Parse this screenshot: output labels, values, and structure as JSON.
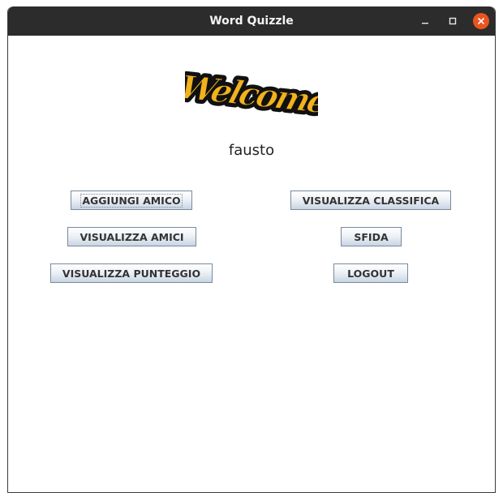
{
  "window": {
    "title": "Word Quizzle"
  },
  "logo": {
    "text": "Welcome",
    "fill_color": "#f2b21c",
    "outline_color": "#111111"
  },
  "user": {
    "username": "fausto"
  },
  "buttons": {
    "add_friend": "AGGIUNGI AMICO",
    "view_ranking": "VISUALIZZA CLASSIFICA",
    "view_friends": "VISUALIZZA AMICI",
    "challenge": "SFIDA",
    "view_score": "VISUALIZZA PUNTEGGIO",
    "logout": "LOGOUT"
  }
}
